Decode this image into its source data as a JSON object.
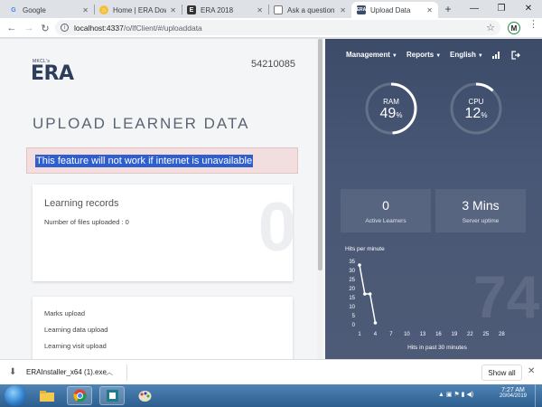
{
  "browser": {
    "tabs": [
      {
        "label": "Google",
        "favicon": "google-icon"
      },
      {
        "label": "Home | ERA Down",
        "favicon": "home-icon"
      },
      {
        "label": "ERA 2018",
        "favicon": "era-icon"
      },
      {
        "label": "Ask a question - El",
        "favicon": "document-icon"
      },
      {
        "label": "Upload Data",
        "favicon": "era-icon"
      }
    ],
    "active_tab": 4,
    "address": {
      "host": "localhost:4337",
      "path": "/o/lfClient/#/uploaddata"
    },
    "profile_initial": "M"
  },
  "page": {
    "brand_small": "MKCL's",
    "brand": "ERA",
    "center_code": "54210085",
    "title": "UPLOAD LEARNER DATA",
    "alert": "This feature will not work if internet is unavailable",
    "learning_records": {
      "title": "Learning records",
      "subtitle": "Number of files uploaded : 0",
      "big_value": "0"
    },
    "upload_items": [
      "Marks upload",
      "Learning data upload",
      "Learning visit upload"
    ]
  },
  "dashboard": {
    "menu": [
      {
        "label": "Management"
      },
      {
        "label": "Reports"
      },
      {
        "label": "English"
      }
    ],
    "ram": {
      "label": "RAM",
      "value": "49",
      "unit": "%",
      "fraction": 0.49
    },
    "cpu": {
      "label": "CPU",
      "value": "12",
      "unit": "%",
      "fraction": 0.12
    },
    "active_learners": {
      "value": "0",
      "label": "Active Learners"
    },
    "server_uptime": {
      "value": "3 Mins",
      "label": "Server uptime"
    },
    "big_number": "74"
  },
  "chart_data": {
    "type": "line",
    "title": "Hits per minute",
    "xlabel": "Hits in past 30 minutes",
    "ylabel": "",
    "x_ticks": [
      1,
      4,
      7,
      10,
      13,
      16,
      19,
      22,
      25,
      28
    ],
    "y_ticks": [
      0,
      5,
      10,
      15,
      20,
      25,
      30,
      35
    ],
    "ylim": [
      0,
      35
    ],
    "xlim": [
      1,
      30
    ],
    "series": [
      {
        "x": [
          1,
          2,
          3,
          4
        ],
        "y": [
          33,
          17,
          17,
          1
        ]
      }
    ]
  },
  "downloads": {
    "filename": "ERAInstaller_x64 (1).exe",
    "show_all": "Show all"
  },
  "taskbar": {
    "time": "7:27 AM",
    "date": "20/04/2019"
  }
}
